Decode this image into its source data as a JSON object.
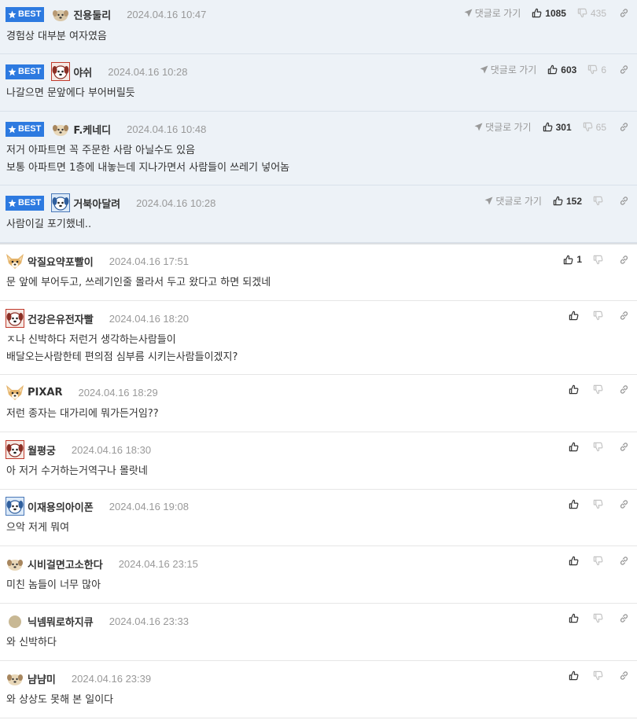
{
  "ui": {
    "best_label": "BEST",
    "reply_label": "댓글로 가기"
  },
  "colors": {
    "best_bg": "#edf2f7",
    "badge": "#2d7ae0",
    "text": "#333333",
    "muted": "#999999"
  },
  "best_comments": [
    {
      "avatar": "puppy-tan-icon",
      "nick": "진용둘리",
      "date": "2024.04.16 10:47",
      "lines": [
        "경험상 대부분 여자였음"
      ],
      "up": "1085",
      "down": "435"
    },
    {
      "avatar": "dog-red-icon",
      "nick": "야쉬",
      "date": "2024.04.16 10:28",
      "lines": [
        "나갈으면 문앞에다 부어버릴듯"
      ],
      "up": "603",
      "down": "6"
    },
    {
      "avatar": "puppy-tan-icon",
      "nick": "F.케네디",
      "date": "2024.04.16 10:48",
      "lines": [
        "저거 아파트면 꼭 주문한 사람 아닐수도 있음",
        "보통 아파트면 1층에 내놓는데 지나가면서 사람들이 쓰레기 넣어놈"
      ],
      "up": "301",
      "down": "65"
    },
    {
      "avatar": "dog-blue-icon",
      "nick": "거북아달려",
      "date": "2024.04.16 10:28",
      "lines": [
        "사람이길 포기했네.."
      ],
      "up": "152",
      "down": ""
    }
  ],
  "comments": [
    {
      "avatar": "chihuahua-icon",
      "nick": "악질요약포빨이",
      "date": "2024.04.16 17:51",
      "lines": [
        "문 앞에 부어두고, 쓰레기인줄 몰라서 두고 왔다고 하면 되겠네"
      ],
      "up": "1",
      "down": ""
    },
    {
      "avatar": "dog-red-icon",
      "nick": "건강은유전자빨",
      "date": "2024.04.16 18:20",
      "lines": [
        "ㅈ나 신박하다 저런거 생각하는사람들이",
        "배달오는사람한테 편의점 심부름 시키는사람들이겠지?"
      ],
      "up": "",
      "down": ""
    },
    {
      "avatar": "chihuahua-icon",
      "nick": "PIXAR",
      "date": "2024.04.16 18:29",
      "lines": [
        "저런 종자는 대가리에 뭐가든거임??"
      ],
      "up": "",
      "down": ""
    },
    {
      "avatar": "dog-red-icon",
      "nick": "월평궁",
      "date": "2024.04.16 18:30",
      "lines": [
        "아 저거 수거하는거역구나 몰랏네"
      ],
      "up": "",
      "down": ""
    },
    {
      "avatar": "dog-blue-icon",
      "nick": "이재용의아이폰",
      "date": "2024.04.16 19:08",
      "lines": [
        "으악 저게 뭐여"
      ],
      "up": "",
      "down": ""
    },
    {
      "avatar": "puppy-tan-icon",
      "nick": "시비걸면고소한다",
      "date": "2024.04.16 23:15",
      "lines": [
        "미친 놈들이 너무 많아"
      ],
      "up": "",
      "down": ""
    },
    {
      "avatar": "dot-avatar-icon",
      "nick": "닉넴뭐로하지큐",
      "date": "2024.04.16 23:33",
      "lines": [
        "와 신박하다"
      ],
      "up": "",
      "down": ""
    },
    {
      "avatar": "puppy-tan-icon",
      "nick": "냠냠미",
      "date": "2024.04.16 23:39",
      "lines": [
        "와 상상도 못해 본 일이다"
      ],
      "up": "",
      "down": ""
    }
  ]
}
